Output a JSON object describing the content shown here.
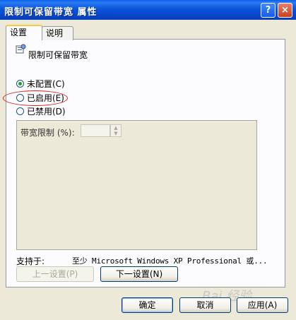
{
  "window": {
    "title": "限制可保留带宽 属性"
  },
  "titlebar": {
    "help_glyph": "?",
    "close_glyph": "×"
  },
  "tabs": [
    {
      "label": "设置"
    },
    {
      "label": "说明"
    }
  ],
  "policy": {
    "name": "限制可保留带宽",
    "icon": "policy-icon"
  },
  "radios": [
    {
      "label": "未配置(C)",
      "checked": true
    },
    {
      "label": "已启用(E)",
      "checked": false
    },
    {
      "label": "已禁用(D)",
      "checked": false
    }
  ],
  "options": {
    "bandwidth_label": "带宽限制 (%):",
    "bandwidth_value": ""
  },
  "support": {
    "label": "支持于:",
    "text": "至少 Microsoft Windows XP Professional 或..."
  },
  "nav": {
    "prev_label": "上一设置(P)",
    "next_label": "下一设置(N)"
  },
  "footer": {
    "ok_label": "确定",
    "cancel_label": "取消",
    "apply_label": "应用(A)"
  },
  "watermark": "Bai 经验",
  "colors": {
    "title_blue": "#0845c8",
    "dialog_bg": "#ece9d8",
    "highlight": "#d11e1e"
  }
}
